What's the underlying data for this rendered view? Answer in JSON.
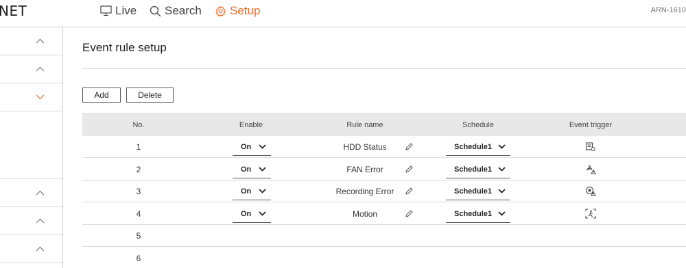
{
  "brand": {
    "logo_text": "NET"
  },
  "nav": {
    "live": "Live",
    "search": "Search",
    "setup": "Setup"
  },
  "model": "ARN-1610",
  "colors": {
    "accent": "#e6692c",
    "header_bg": "#e8e8e8"
  },
  "sidebar": {
    "rows": [
      {
        "chevron": "chevron-up-icon"
      },
      {
        "chevron": "chevron-up-icon"
      },
      {
        "chevron": "chevron-down-icon",
        "active": true
      },
      {
        "chevron": "none"
      },
      {
        "chevron": "chevron-up-icon"
      },
      {
        "chevron": "chevron-up-icon"
      },
      {
        "chevron": "chevron-up-icon"
      }
    ]
  },
  "page": {
    "title": "Event rule setup",
    "add_label": "Add",
    "delete_label": "Delete"
  },
  "table": {
    "headers": {
      "no": "No.",
      "enable": "Enable",
      "rule_name": "Rule name",
      "schedule": "Schedule",
      "event_trigger": "Event trigger"
    },
    "rows": [
      {
        "no": "1",
        "enable": "On",
        "rule_name": "HDD Status",
        "schedule": "Schedule1",
        "trigger_icon": "hdd-status-icon"
      },
      {
        "no": "2",
        "enable": "On",
        "rule_name": "FAN Error",
        "schedule": "Schedule1",
        "trigger_icon": "fan-error-icon"
      },
      {
        "no": "3",
        "enable": "On",
        "rule_name": "Recording Error",
        "schedule": "Schedule1",
        "trigger_icon": "recording-error-icon"
      },
      {
        "no": "4",
        "enable": "On",
        "rule_name": "Motion",
        "schedule": "Schedule1",
        "trigger_icon": "motion-icon"
      },
      {
        "no": "5"
      },
      {
        "no": "6"
      }
    ]
  }
}
